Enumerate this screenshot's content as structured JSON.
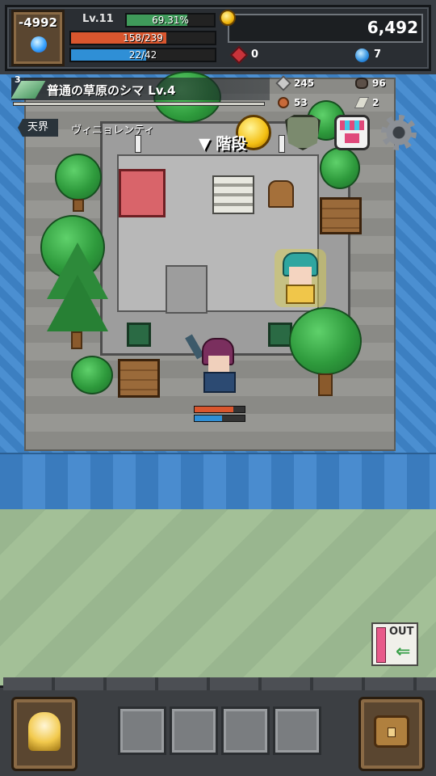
{
  "hud": {
    "badge_value": "-4992",
    "level": "Lv.11",
    "xp": {
      "text": "69.31%",
      "fraction": 0.6931
    },
    "hp": {
      "text": "158/239",
      "fraction": 0.661
    },
    "mp": {
      "text": "22/42",
      "fraction": 0.524
    },
    "gold": "6,492",
    "red_crystals": "0",
    "blue_gems": "7"
  },
  "location": {
    "floor_number": "3",
    "name": "普通の草原のシマ Lv.4",
    "realm_tag": "天界",
    "realm_place": "ヴィニョレンティ"
  },
  "stats": {
    "attack": "245",
    "meat": "53",
    "ore": "96",
    "feather": "2"
  },
  "map": {
    "stairs_label": "▼ 階段",
    "player_hp_fraction": 0.78,
    "player_mp_fraction": 0.55,
    "exit_label": "OUT"
  },
  "colors": {
    "hp": "#d9562e",
    "mp": "#2f8fd6",
    "xp": "#3f9a5a",
    "water": "#3c7fc1"
  },
  "icons": {
    "top_row": [
      "coin-shop-icon",
      "mask-icon",
      "shop-stall-icon",
      "settings-gear-icon"
    ],
    "dock_left": "hero-portrait-icon",
    "dock_right": "backpack-icon"
  }
}
